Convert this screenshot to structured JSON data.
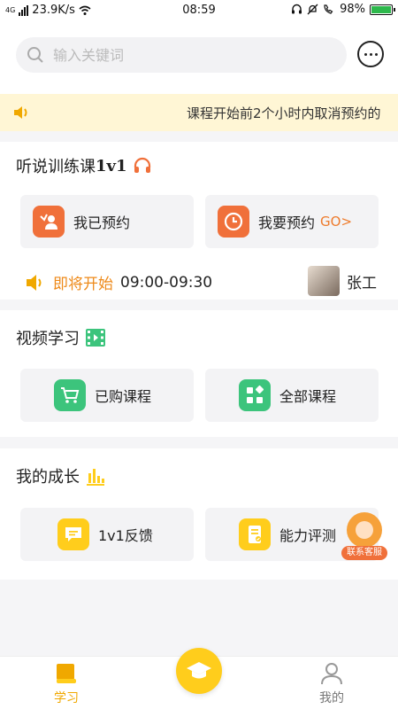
{
  "status_bar": {
    "network": "4G",
    "speed": "23.9K/s",
    "time": "08:59",
    "battery": "98%"
  },
  "search": {
    "placeholder": "输入关键词"
  },
  "notice": {
    "text": "课程开始前2个小时内取消预约的"
  },
  "listening": {
    "title_cn": "听说训练课",
    "title_1v1": "1v1",
    "booked_label": "我已预约",
    "book_label": "我要预约",
    "go_label": "GO>",
    "upcoming_tag": "即将开始",
    "upcoming_time": "09:00-09:30",
    "teacher_name": "张工"
  },
  "video": {
    "title": "视频学习",
    "purchased_label": "已购课程",
    "all_label": "全部课程"
  },
  "growth": {
    "title": "我的成长",
    "feedback_label": "1v1反馈",
    "assessment_label": "能力评测"
  },
  "customer_service": {
    "label": "联系客服"
  },
  "tabbar": {
    "learn_label": "学习",
    "mine_label": "我的"
  },
  "colors": {
    "accent_yellow": "#ffcd1c",
    "accent_orange": "#f0703a",
    "accent_green": "#3cc47c",
    "notice_bg": "#fff6d5"
  }
}
